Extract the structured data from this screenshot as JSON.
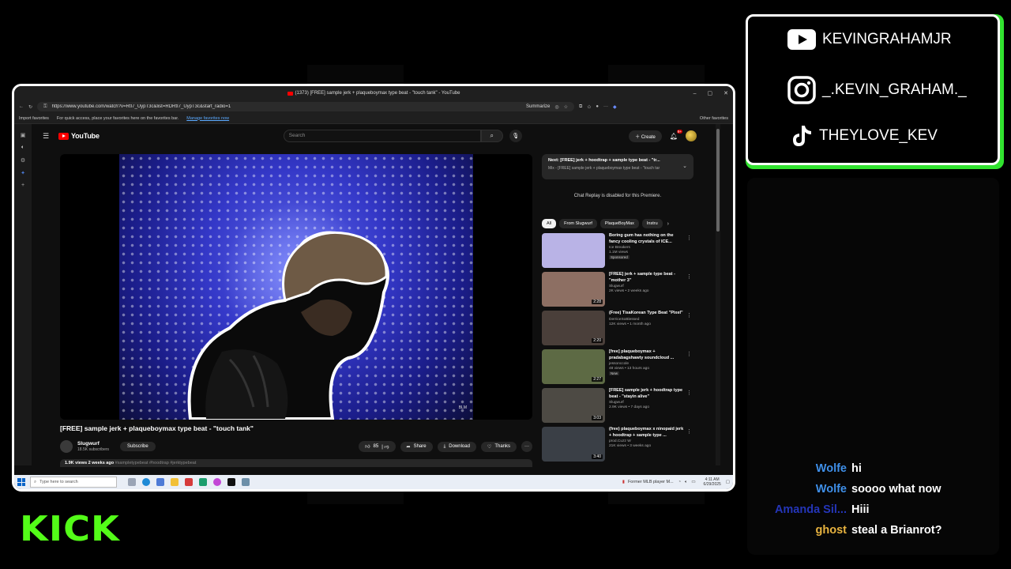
{
  "browser": {
    "tab_title": "(1373) [FREE] sample jerk + plaqueboymax type beat - \"touch tank\" - YouTube",
    "window_controls": {
      "minimize": "–",
      "maximize": "▢",
      "close": "✕"
    },
    "url": "https://www.youtube.com/watch?v=RtI7_UypT3c&list=RDRtI7_UypT3c&start_radio=1",
    "summarize_label": "Summarize",
    "favorites": {
      "import": "Import favorites",
      "hint": "For quick access, place your favorites here on the favorites bar.",
      "manage_link": "Manage favorites now",
      "other": "Other favorites"
    }
  },
  "youtube": {
    "logo_text": "YouTube",
    "search_placeholder": "Search",
    "create_label": "Create",
    "notif_badge": "9+",
    "video_watermark": "BLM",
    "video_title": "[FREE] sample jerk + plaqueboymax type beat - \"touch tank\"",
    "channel_name": "Slugwurf",
    "channel_subs": "18.5K subscribers",
    "subscribe_label": "Subscribe",
    "like_count": "85",
    "share_label": "Share",
    "download_label": "Download",
    "thanks_label": "Thanks",
    "more_label": "···",
    "description": {
      "stats": "1.9K views  2 weeks ago",
      "tags": "#sampletypebeat #hoodtrap #jerktypebeat"
    },
    "next": {
      "title": "Next: [FREE] jerk + hoodtrap + sample type beat - \"tr...",
      "subtitle": "Mix - [FREE] sample jerk + plaqueboymax type beat - \"touch tar"
    },
    "chat_disabled": "Chat Replay is disabled for this Premiere.",
    "chips": [
      "All",
      "From Slugwurf",
      "PlaqueBoyMax",
      "Instru"
    ],
    "recommendations": [
      {
        "title": "Boring gum has nothing on the fancy cooling crystals of ICE...",
        "channel": "Ice Breakers",
        "meta": "1.1M views",
        "tag": "Sponsored",
        "duration": "",
        "thumb_color": "#b9b3e6"
      },
      {
        "title": "[FREE] jerk + sample type beat - \"mother 3\"",
        "channel": "Slugwurf",
        "meta": "2K views • 2 weeks ago",
        "tag": "",
        "duration": "2:28",
        "thumb_color": "#8d6f63"
      },
      {
        "title": "(Free) TisaKorean Type Beat \"Pixel\"",
        "channel": "DerriceSoBlessed",
        "meta": "12K views • 1 month ago",
        "tag": "",
        "duration": "2:20",
        "thumb_color": "#4a3f3a"
      },
      {
        "title": "[free] plaqueboymax + pradabagshawty soundcloud ...",
        "channel": "jessonccole",
        "meta": "48 views • 13 hours ago",
        "tag": "New",
        "duration": "2:27",
        "thumb_color": "#5d6a44"
      },
      {
        "title": "[FREE] sample jerk + hoodtrap type beat - \"stayin alive\"",
        "channel": "Slugwurf",
        "meta": "2.9K views • 7 days ago",
        "tag": "",
        "duration": "3:03",
        "thumb_color": "#4d4a44"
      },
      {
        "title": "(free) plaqueboymax x ninopaid jerk + hoodtrap + sample type ...",
        "channel": "prod.Cuzz W",
        "meta": "21K views • 3 weeks ago",
        "tag": "",
        "duration": "3:40",
        "thumb_color": "#3a3f46"
      }
    ]
  },
  "taskbar": {
    "search_placeholder": "Type here to search",
    "news": "Former MLB player M...",
    "time": "4:11 AM",
    "date": "6/29/2025"
  },
  "socials": {
    "youtube": "KEVINGRAHAMJR",
    "instagram": "_.KEVIN_GRAHAM._",
    "tiktok": "THEYLOVE_KEV"
  },
  "chat": [
    {
      "user": "Wolfe",
      "color": "#3f8fe8",
      "message": "hi"
    },
    {
      "user": "Wolfe",
      "color": "#3f8fe8",
      "message": "soooo what now"
    },
    {
      "user": "Amanda Sil...",
      "color": "#2a3ed8",
      "message": "Hiii"
    },
    {
      "user": "ghost",
      "color": "#e8b33f",
      "message": "steal a Brianrot?"
    }
  ],
  "brand": {
    "kick_logo": "KICK",
    "accent": "#53fc18",
    "frame_accent": "#31e32f"
  }
}
